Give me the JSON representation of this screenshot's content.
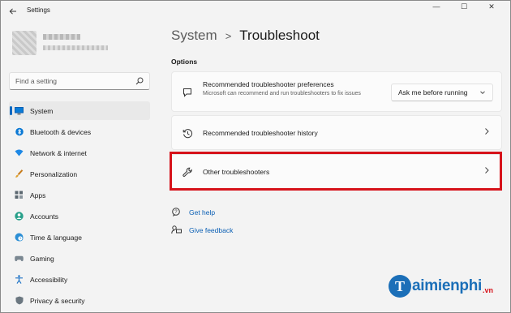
{
  "app": {
    "title": "Settings"
  },
  "window_controls": [
    "—",
    "☐",
    "✕"
  ],
  "search": {
    "placeholder": "Find a setting"
  },
  "sidebar": {
    "items": [
      {
        "label": "System",
        "icon": "monitor-icon",
        "active": true
      },
      {
        "label": "Bluetooth & devices",
        "icon": "bluetooth-icon"
      },
      {
        "label": "Network & internet",
        "icon": "wifi-icon"
      },
      {
        "label": "Personalization",
        "icon": "brush-icon"
      },
      {
        "label": "Apps",
        "icon": "apps-icon"
      },
      {
        "label": "Accounts",
        "icon": "person-icon"
      },
      {
        "label": "Time & language",
        "icon": "globe-clock-icon"
      },
      {
        "label": "Gaming",
        "icon": "gamepad-icon"
      },
      {
        "label": "Accessibility",
        "icon": "accessibility-icon"
      },
      {
        "label": "Privacy & security",
        "icon": "shield-icon"
      }
    ]
  },
  "breadcrumb": {
    "parent": "System",
    "separator": ">",
    "current": "Troubleshoot"
  },
  "options": {
    "heading": "Options",
    "cards": [
      {
        "title": "Recommended troubleshooter preferences",
        "description": "Microsoft can recommend and run troubleshooters to fix issues",
        "dropdown_value": "Ask me before running",
        "icon": "chat-bubble-icon"
      },
      {
        "title": "Recommended troubleshooter history",
        "icon": "history-icon"
      },
      {
        "title": "Other troubleshooters",
        "icon": "wrench-icon"
      }
    ]
  },
  "links": {
    "get_help": "Get help",
    "give_feedback": "Give feedback"
  },
  "watermark": {
    "letter": "T",
    "text": "aimienphi",
    "suffix": ".vn"
  },
  "colors": {
    "accent": "#0067c0",
    "highlight_border": "#d6121a",
    "link": "#0a5fb4"
  }
}
